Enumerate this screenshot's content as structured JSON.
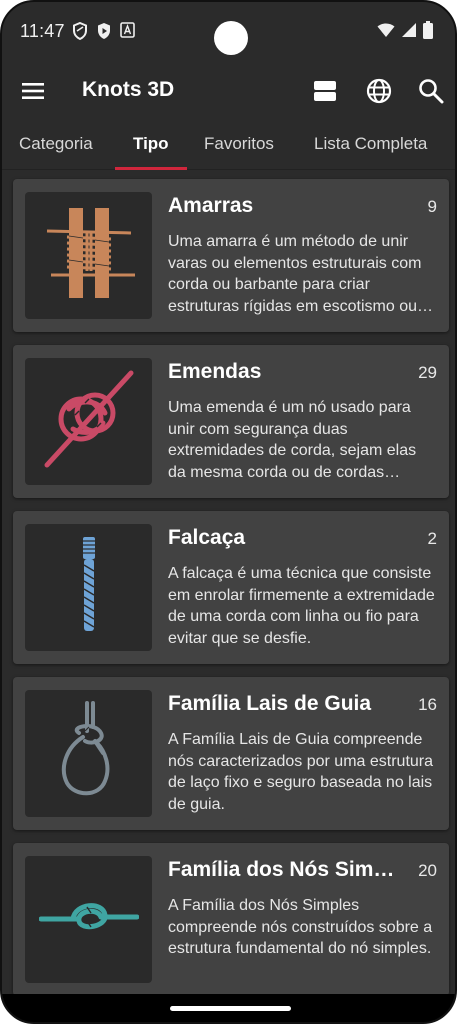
{
  "status_bar": {
    "time": "11:47",
    "left_icons": [
      "vpn-shield-icon",
      "play-protect-icon",
      "keyboard-a-icon"
    ],
    "right_icons": [
      "wifi-icon",
      "signal-icon",
      "battery-icon"
    ]
  },
  "app_bar": {
    "title": "Knots 3D",
    "icons": [
      "menu-icon",
      "view-toggle-icon",
      "language-globe-icon",
      "search-icon"
    ]
  },
  "tabs": [
    {
      "label": "Categoria"
    },
    {
      "label": "Tipo"
    },
    {
      "label": "Favoritos"
    },
    {
      "label": "Lista Completa"
    }
  ],
  "active_tab": "Tipo",
  "colors": {
    "background": "#2b2b2b",
    "card": "#424242",
    "accent": "#d0263c"
  },
  "cards": [
    {
      "title": "Amarras",
      "count": "9",
      "description": "Uma amarra é um método de unir varas ou elementos estruturais com corda ou barbante para criar estruturas rígidas em escotismo ou engenharia.",
      "icon": "lashing-knot-icon",
      "icon_color": "#c8865a"
    },
    {
      "title": "Emendas",
      "count": "29",
      "description": "Uma emenda é um nó usado para unir com segurança duas extremidades de corda, sejam elas da mesma corda ou de cordas diferentes.",
      "icon": "bend-knot-icon",
      "icon_color": "#c94a66"
    },
    {
      "title": "Falcaça",
      "count": "2",
      "description": "A falcaça é uma técnica que consiste em enrolar firmemente a extremidade de uma corda com linha ou fio para evitar que se desfie.",
      "icon": "whipping-icon",
      "icon_color": "#6ea3d6"
    },
    {
      "title": "Família Lais de Guia",
      "count": "16",
      "description": "A Família Lais de Guia compreende nós caracterizados por uma estrutura de laço fixo e seguro baseada no lais de guia.",
      "icon": "bowline-loop-icon",
      "icon_color": "#7d8a93"
    },
    {
      "title": "Família dos Nós Simples",
      "count": "20",
      "description": "A Família dos Nós Simples compreende nós construídos sobre a estrutura fundamental do nó simples.",
      "icon": "overhand-knot-icon",
      "icon_color": "#3fa5a2"
    }
  ]
}
